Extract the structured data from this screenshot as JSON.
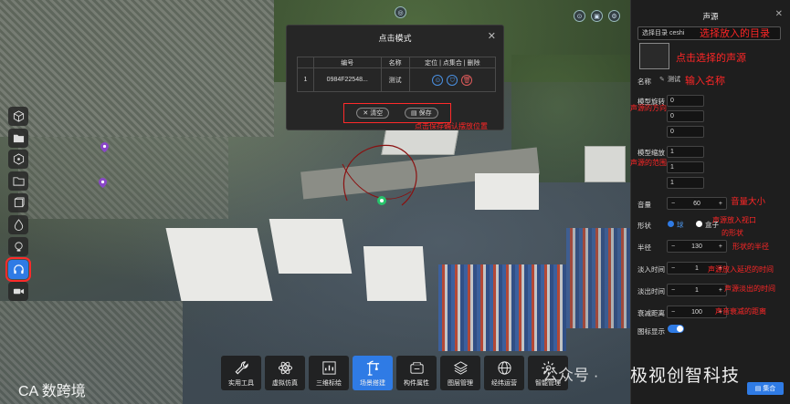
{
  "modal": {
    "title": "点击模式",
    "columns": [
      "",
      "编号",
      "名称",
      "定位 | 点集合 | 删除"
    ],
    "rows": [
      {
        "index": "1",
        "id": "0984F22548...",
        "name": "测试"
      }
    ],
    "clear_label": "清空",
    "save_label": "保存"
  },
  "panel": {
    "title": "声源",
    "directory": "选择目录  ceshi",
    "name_label": "名称",
    "name_value": "测试",
    "rotation_label": "模型旋转",
    "rotation_values": [
      "0",
      "0",
      "0"
    ],
    "scale_label": "模型缩放",
    "scale_values": [
      "1",
      "1",
      "1"
    ],
    "volume_label": "音量",
    "volume_value": "60",
    "shape_label": "形状",
    "shape_opt1": "球",
    "shape_opt2": "盒子",
    "radius_label": "半径",
    "radius_value": "130",
    "fadein_label": "淡入时间",
    "fadein_value": "1",
    "fadeout_label": "淡出时间",
    "fadeout_value": "1",
    "decay_label": "衰减距离",
    "decay_value": "100",
    "icon_label": "图标显示",
    "save_set_label": "集合"
  },
  "annotations": {
    "select_dir": "选择放入的目录",
    "select_sound": "点击选择的声源",
    "input_name": "输入名称",
    "rotation": "声源的方向",
    "scale": "声源的范围",
    "volume": "音量大小",
    "shape": "声源放入视口",
    "shape2": "的形状",
    "radius": "形状的半径",
    "fadein": "声源放入延迟的时间",
    "fadeout": "声源淡出的时间",
    "decay": "声音衰减的距离",
    "save_hint": "点击保存确认摆放位置"
  },
  "toolbar": [
    {
      "label": "实用工具",
      "icon": "wrench-icon"
    },
    {
      "label": "虚拟仿真",
      "icon": "atom-icon"
    },
    {
      "label": "三维标绘",
      "icon": "chart-icon"
    },
    {
      "label": "场景搭建",
      "icon": "crane-icon"
    },
    {
      "label": "构件属性",
      "icon": "component-icon"
    },
    {
      "label": "图层管理",
      "icon": "layers-icon"
    },
    {
      "label": "经纬运营",
      "icon": "globe-icon"
    },
    {
      "label": "智能管理",
      "icon": "gear-icon"
    }
  ],
  "watermarks": {
    "left": "CA 数跨境",
    "right_prefix": "公众号 ·",
    "right": "极视创智科技"
  },
  "colors": {
    "accent": "#2f7be5",
    "annotation": "#ff2626",
    "danger": "#e05b5b"
  }
}
